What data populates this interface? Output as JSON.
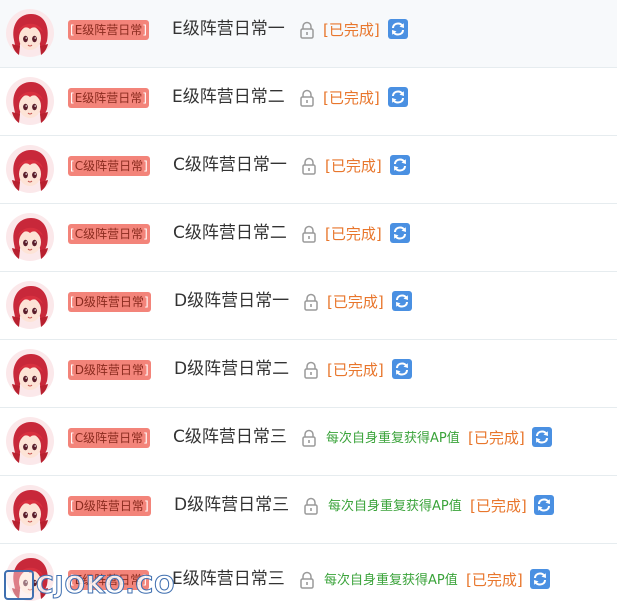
{
  "tasks": [
    {
      "tag": "E级阵营日常",
      "title": "E级阵营日常一",
      "desc": "",
      "status": "[已完成]"
    },
    {
      "tag": "E级阵营日常",
      "title": "E级阵营日常二",
      "desc": "",
      "status": "[已完成]"
    },
    {
      "tag": "C级阵营日常",
      "title": "C级阵营日常一",
      "desc": "",
      "status": "[已完成]"
    },
    {
      "tag": "C级阵营日常",
      "title": "C级阵营日常二",
      "desc": "",
      "status": "[已完成]"
    },
    {
      "tag": "D级阵营日常",
      "title": "D级阵营日常一",
      "desc": "",
      "status": "[已完成]"
    },
    {
      "tag": "D级阵营日常",
      "title": "D级阵营日常二",
      "desc": "",
      "status": "[已完成]"
    },
    {
      "tag": "C级阵营日常",
      "title": "C级阵营日常三",
      "desc": "每次自身重复获得AP值",
      "status": "[已完成]"
    },
    {
      "tag": "D级阵营日常",
      "title": "D级阵营日常三",
      "desc": "每次自身重复获得AP值",
      "status": "[已完成]"
    },
    {
      "tag": "E级阵营日常",
      "title": "E级阵营日常三",
      "desc": "每次自身重复获得AP值",
      "status": "[已完成]"
    }
  ],
  "tag_bracket_left": "[",
  "tag_bracket_right": "]",
  "icons": {
    "avatar": "anime-girl-avatar",
    "lock": "lock-icon",
    "refresh": "refresh-icon"
  },
  "colors": {
    "tag_bg": "#f3847a",
    "status": "#e8762c",
    "desc": "#3aa33a",
    "refresh_bg": "#4a90e2"
  },
  "watermark": "CJOKO.CO"
}
